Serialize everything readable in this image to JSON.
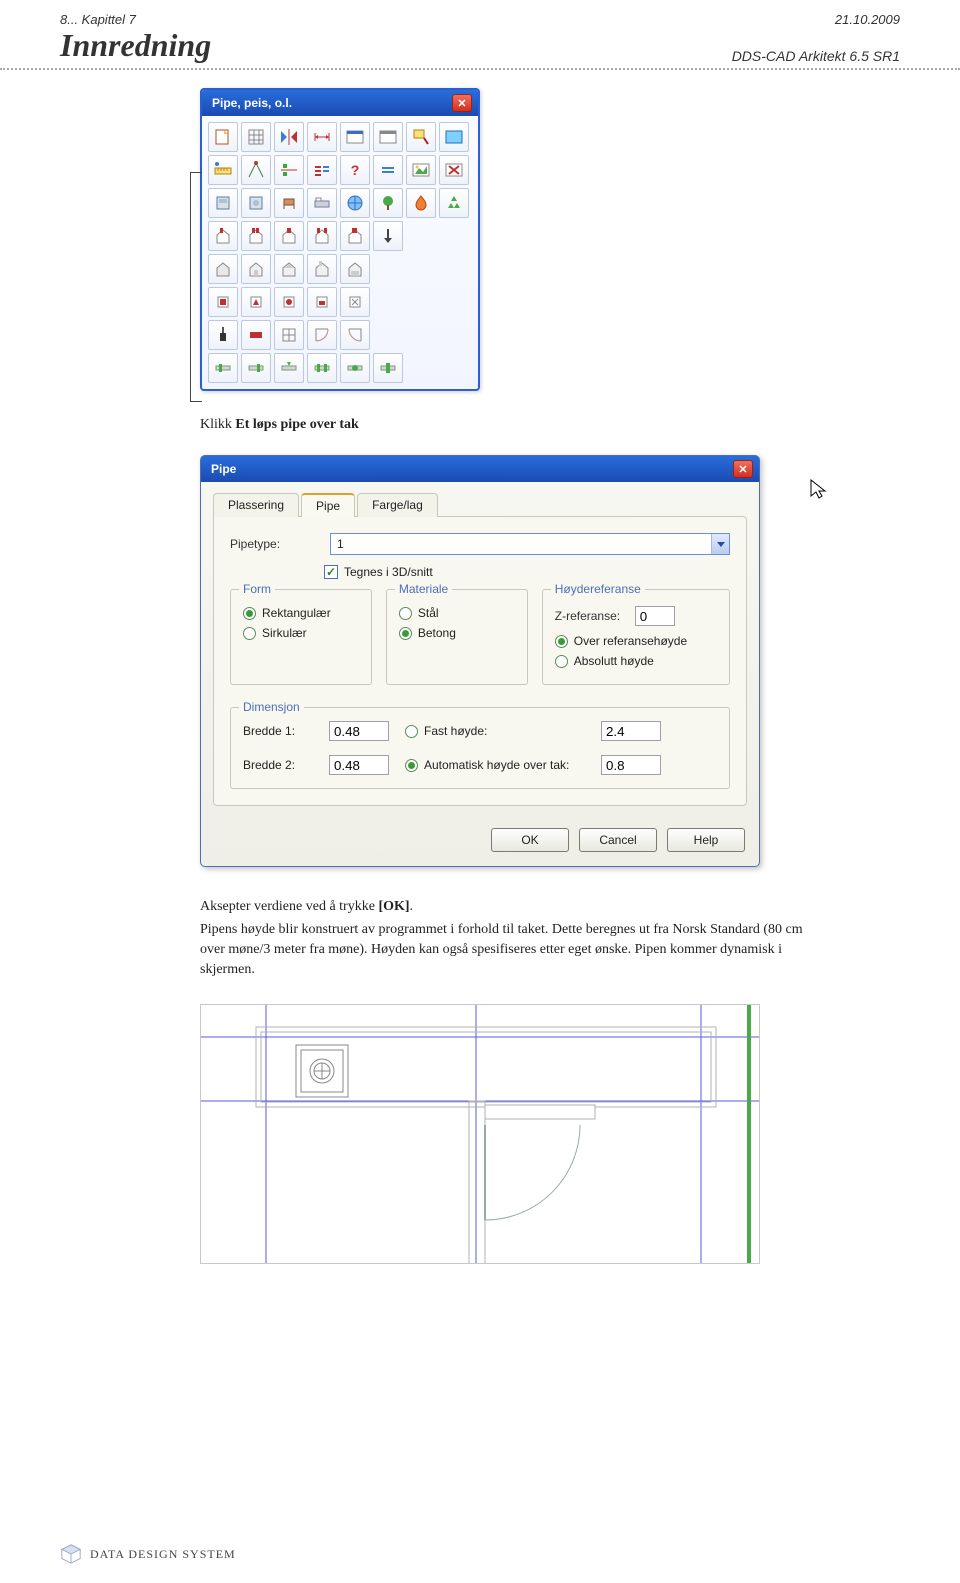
{
  "header": {
    "chapter": "8... Kapittel 7",
    "date": "21.10.2009",
    "title": "Innredning",
    "right": "DDS-CAD Arkitekt 6.5 SR1"
  },
  "toolbox": {
    "title": "Pipe, peis, o.l."
  },
  "instruction1": {
    "pre": "Klikk ",
    "bold": "Et løps pipe over tak"
  },
  "dialog": {
    "title": "Pipe",
    "tabs": {
      "t1": "Plassering",
      "t2": "Pipe",
      "t3": "Farge/lag"
    },
    "pipetype_label": "Pipetype:",
    "pipetype_value": "1",
    "tegnes_label": "Tegnes i 3D/snitt",
    "form": {
      "legend": "Form",
      "rekt": "Rektangulær",
      "sirk": "Sirkulær"
    },
    "materiale": {
      "legend": "Materiale",
      "stal": "Stål",
      "betong": "Betong"
    },
    "hoyderef": {
      "legend": "Høydereferanse",
      "zref_label": "Z-referanse:",
      "zref_value": "0",
      "over": "Over referansehøyde",
      "abs": "Absolutt høyde"
    },
    "dimensjon": {
      "legend": "Dimensjon",
      "b1_label": "Bredde 1:",
      "b1_value": "0.48",
      "b2_label": "Bredde 2:",
      "b2_value": "0.48",
      "fast_label": "Fast høyde:",
      "fast_value": "2.4",
      "auto_label": "Automatisk høyde over tak:",
      "auto_value": "0.8"
    },
    "buttons": {
      "ok": "OK",
      "cancel": "Cancel",
      "help": "Help"
    }
  },
  "body_text": "Aksepter verdiene ved å trykke [OK].\nPipens høyde blir konstruert av programmet i forhold til taket. Dette beregnes ut fra Norsk Standard (80 cm over møne/3 meter fra møne). Høyden kan også spesifiseres etter eget ønske. Pipen kommer dynamisk i skjermen.",
  "body_parts": {
    "p1_pre": "Aksepter verdiene ved å trykke ",
    "p1_bold": "[OK]",
    "p1_post": ".",
    "p2": "Pipens høyde blir konstruert av programmet i forhold til taket. Dette beregnes ut fra Norsk Standard (80 cm over møne/3 meter fra møne). Høyden kan også spesifiseres etter eget ønske. Pipen kommer dynamisk i skjermen."
  },
  "footer": {
    "brand": "DATA DESIGN SYSTEM"
  }
}
